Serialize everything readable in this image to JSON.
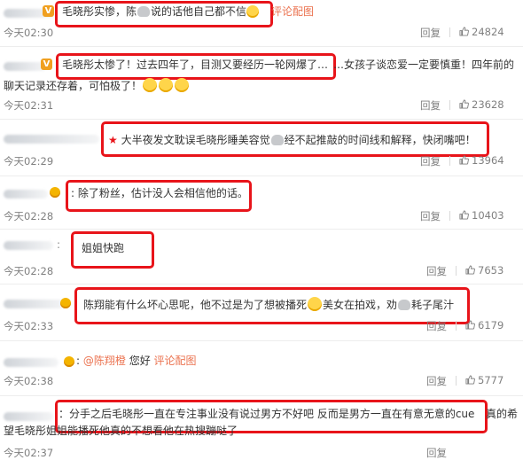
{
  "comments": [
    {
      "text": "毛晓彤实惨，陈",
      "text_b": "说的话他自己都不信",
      "link": "评论配图",
      "time": "今天02:30",
      "reply": "回复",
      "likes": "24824"
    },
    {
      "text": "毛晓彤太惨了！过去四年了，目测又要经历一轮网爆了…",
      "text_tail": "…女孩子谈恋爱一定要慎重！四年前的",
      "text_line2": "聊天记录还存着，可怕极了！",
      "time": "今天02:31",
      "reply": "回复",
      "likes": "23628"
    },
    {
      "text": "大半夜发文耽误毛晓彤睡美容觉",
      "text_b": "经不起推敲的时间线和解释，快闭嘴吧！",
      "time": "今天02:29",
      "reply": "回复",
      "likes": "13964"
    },
    {
      "text": "除了粉丝，估计没人会相信他的话。",
      "time": "今天02:28",
      "reply": "回复",
      "likes": "10403"
    },
    {
      "text": "姐姐快跑",
      "time": "今天02:28",
      "reply": "回复",
      "likes": "7653"
    },
    {
      "text": "陈翔能有什么坏心思呢，他不过是为了想被播死",
      "text_b": "美女在拍戏，劝",
      "text_c": "耗子尾汁",
      "time": "今天02:33",
      "reply": "回复",
      "likes": "6179"
    },
    {
      "mention": "@陈翔橙",
      "text": "您好",
      "link": "评论配图",
      "time": "今天02:38",
      "reply": "回复",
      "likes": "5777"
    },
    {
      "text": "：分手之后毛晓彤一直在专注事业没有说过男方不好吧 反而是男方一直在有意无意的cue",
      "text_tail": "真的希",
      "text_line2": "望毛晓彤姐姐能播死他真的不想看他在热搜蹦哒了",
      "time": "今天02:37",
      "reply": "回复"
    }
  ],
  "colors": {
    "highlight": "#e8141a",
    "badge": "#f0a020",
    "link": "#eb7350",
    "meta": "#808080"
  },
  "icons": {
    "like": "thumb-up-icon",
    "verified": "v-badge-icon",
    "crown": "crown-badge-icon"
  }
}
